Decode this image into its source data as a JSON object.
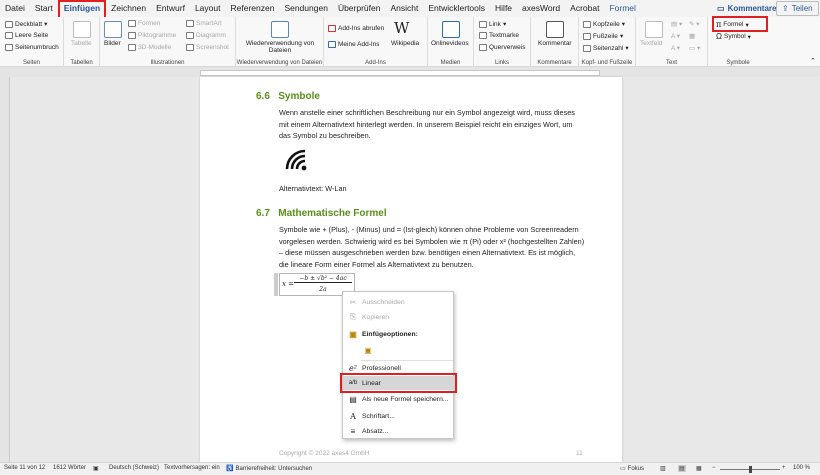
{
  "tabs": [
    "Datei",
    "Start",
    "Einfügen",
    "Zeichnen",
    "Entwurf",
    "Layout",
    "Referenzen",
    "Sendungen",
    "Überprüfen",
    "Ansicht",
    "Entwicklertools",
    "Hilfe",
    "axesWord",
    "Acrobat",
    "Formel"
  ],
  "tab_right": {
    "comments": "Kommentare",
    "share": "Teilen"
  },
  "ribbon": {
    "seiten": {
      "label": "Seiten",
      "items": [
        "Deckblatt",
        "Leere Seite",
        "Seitenumbruch"
      ]
    },
    "tabellen": {
      "label": "Tabellen",
      "item": "Tabelle"
    },
    "illustrationen": {
      "label": "Illustrationen",
      "bilder": "Bilder",
      "items": [
        "Formen",
        "Piktogramme",
        "3D-Modelle",
        "SmartArt",
        "Diagramm",
        "Screenshot"
      ]
    },
    "verwendung": {
      "label": "Wiederverwendung von Dateien",
      "item": "Wiederverwendung von Dateien"
    },
    "addins": {
      "label": "Add-Ins",
      "items": [
        "Add-Ins abrufen",
        "Meine Add-Ins"
      ],
      "wiki": "Wikipedia"
    },
    "medien": {
      "label": "Medien",
      "item": "Onlinevideos"
    },
    "links": {
      "label": "Links",
      "items": [
        "Link",
        "Textmarke",
        "Querverweis"
      ]
    },
    "kommentare": {
      "label": "Kommentare",
      "item": "Kommentar"
    },
    "kopf": {
      "label": "Kopf- und Fußzeile",
      "items": [
        "Kopfzeile",
        "Fußzeile",
        "Seitenzahl"
      ]
    },
    "text": {
      "label": "Text",
      "item": "Textfeld"
    },
    "symbole": {
      "label": "Symbole",
      "items": [
        "Formel",
        "Symbol"
      ]
    }
  },
  "document": {
    "h1_num": "6.6",
    "h1": "Symbole",
    "p1": "Wenn anstelle einer schriftlichen Beschreibung nur ein Symbol angezeigt wird, muss dieses mit einem Alternativtext hinterlegt werden. In unserem Beispiel reicht ein einziges Wort, um das Symbol zu beschreiben.",
    "alt": "Alternativtext: W-Lan",
    "h2_num": "6.7",
    "h2": "Mathematische Formel",
    "p2": "Symbole wie + (Plus), - (Minus) und = (Ist-gleich) können ohne Probleme von Screenreadern vorgelesen werden. Schwierig wird es bei Symbolen wie π (Pi) oder x² (hochgestellten Zahlen) – diese müssen ausgeschrieben werden bzw. benötigen einen Alternativtext. Es ist möglich, die lineare Form einer Formel als Alternativtext zu benutzen.",
    "footer_left": "Copyright © 2022 axes4 GmbH",
    "footer_right": "11"
  },
  "equation": {
    "lhs": "x =",
    "numerator": "−b ± √b² − 4ac",
    "denominator": "2a"
  },
  "context_menu": [
    "Ausschneiden",
    "Kopieren",
    "Einfügeoptionen:",
    "Professionell",
    "Linear",
    "Als neue Formel speichern...",
    "Schriftart...",
    "Absatz..."
  ],
  "status": {
    "page": "Seite 11 von 12",
    "words": "1612 Wörter",
    "lang": "Deutsch (Schweiz)",
    "predict": "Textvorhersagen: ein",
    "access": "Barrierefreiheit: Untersuchen",
    "focus": "Fokus",
    "zoom": "100 %"
  }
}
